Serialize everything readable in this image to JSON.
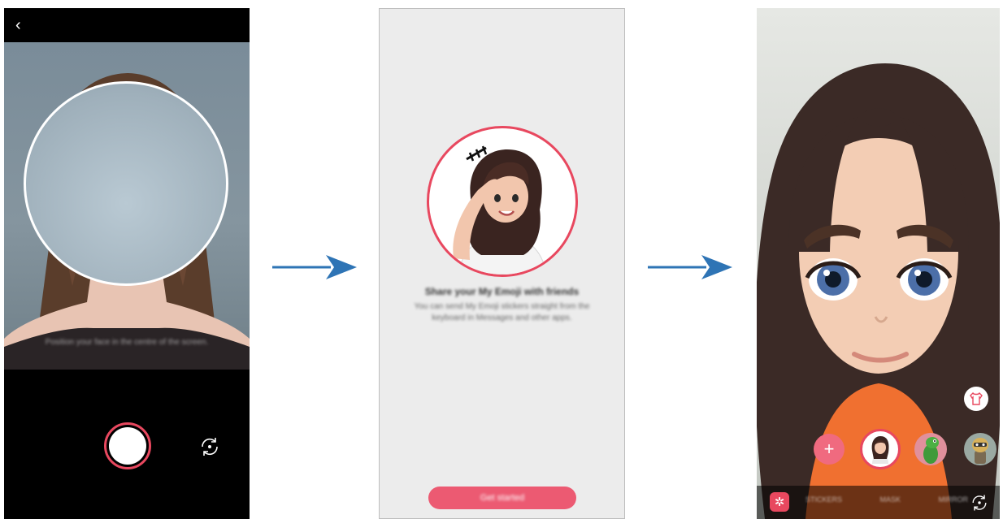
{
  "screen1": {
    "back_icon": "chevron-left-icon",
    "back_glyph": "‹",
    "hint": "Position your face in the centre of the screen.",
    "shutter_icon": "shutter-button",
    "switch_camera_icon": "switch-camera-icon"
  },
  "screen2": {
    "title": "Share your My Emoji with friends",
    "description": "You can send My Emoji stickers straight from the keyboard in Messages and other apps.",
    "button_label": "Get started"
  },
  "screen3": {
    "tabs": [
      "STICKERS",
      "MASK",
      "MIRROR"
    ],
    "add_glyph": "+",
    "sticker_glyph": "✲",
    "shirt_icon": "shirt-icon",
    "switch_camera_icon": "switch-camera-icon"
  },
  "colors": {
    "accent": "#e8485f",
    "button": "#ec5a72",
    "arrow": "#2e74b5"
  }
}
